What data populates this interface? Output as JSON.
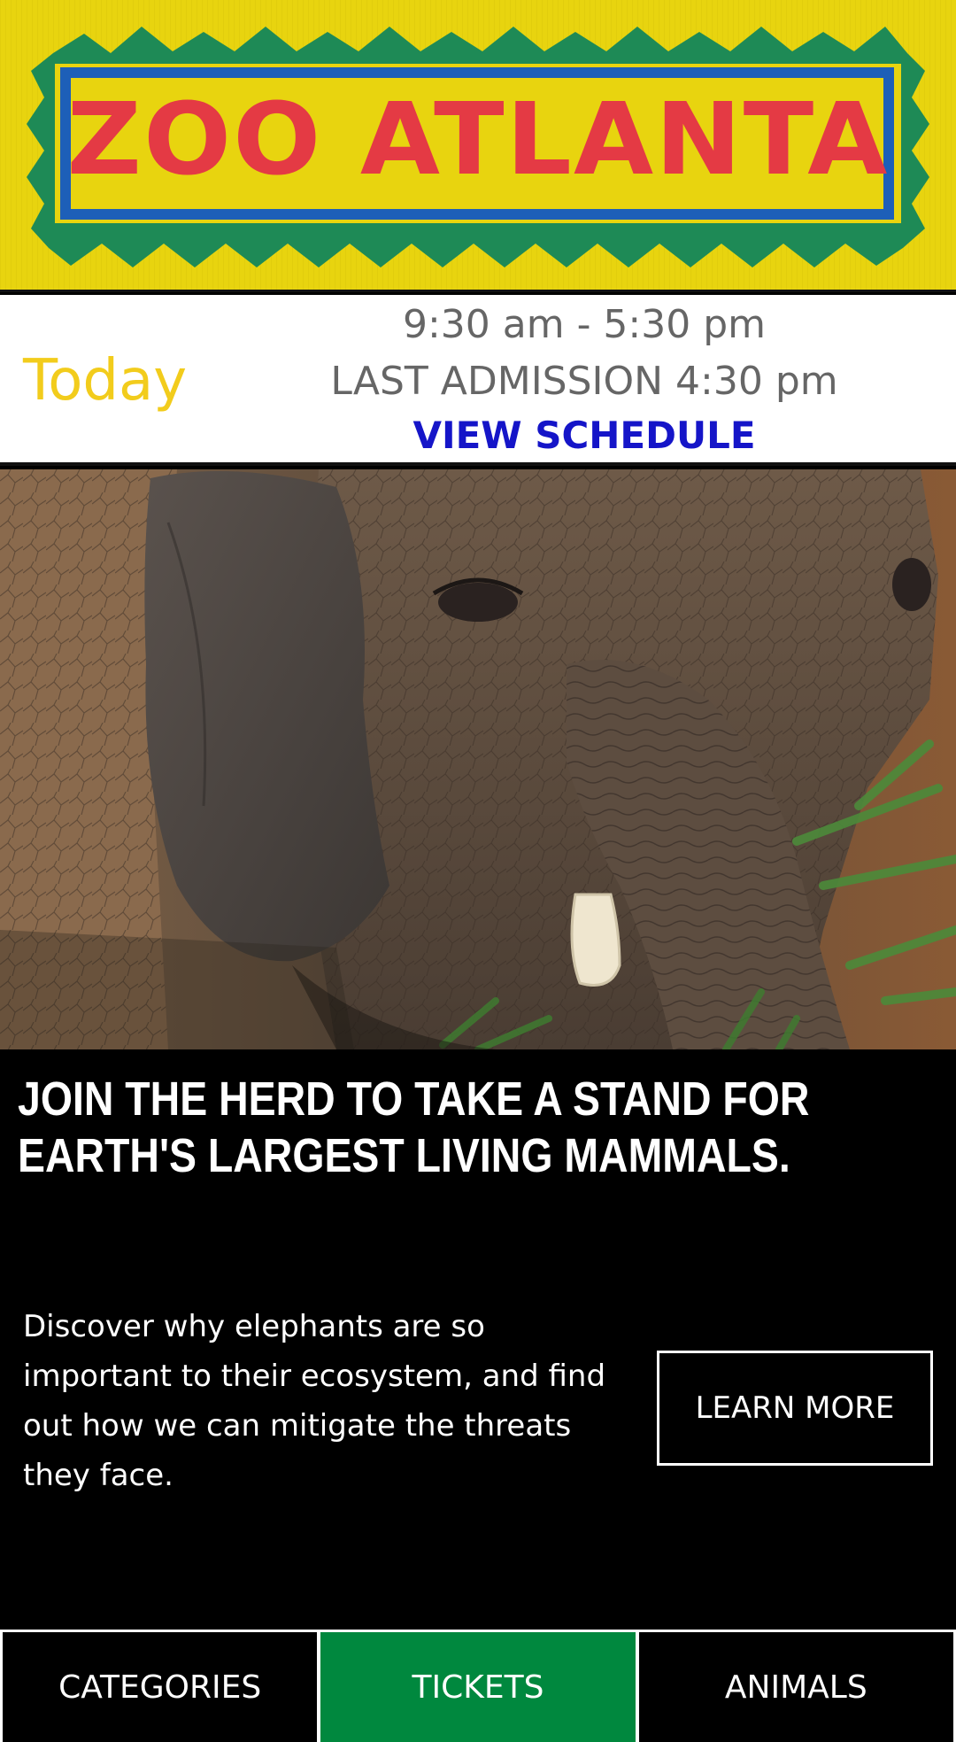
{
  "logo": {
    "text": "ZOO ATLANTA",
    "colors": {
      "background": "#e8d40f",
      "zigzag": "#1e8a56",
      "frame": "#1d5fb8",
      "text": "#e43a44"
    }
  },
  "hours": {
    "today_label": "Today",
    "time_range": "9:30 am - 5:30 pm",
    "last_admission": "LAST ADMISSION 4:30 pm",
    "view_schedule": "VIEW SCHEDULE",
    "colors": {
      "today": "#f2cc1c",
      "link": "#1515c8"
    }
  },
  "hero": {
    "image_subject": "elephant-photo"
  },
  "promo": {
    "headline": "JOIN THE HERD TO TAKE A STAND FOR EARTH'S LARGEST LIVING MAMMALS.",
    "body": "Discover why elephants are so important to their ecosystem, and find out how we can mitigate the threats they face.",
    "button_label": "LEARN MORE"
  },
  "bottom_nav": {
    "tabs": [
      {
        "label": "CATEGORIES",
        "active": false
      },
      {
        "label": "TICKETS",
        "active": true
      },
      {
        "label": "ANIMALS",
        "active": false
      }
    ],
    "active_color": "#00883e"
  }
}
